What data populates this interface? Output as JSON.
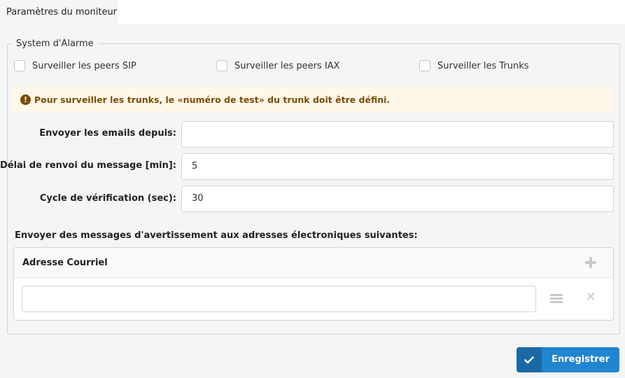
{
  "tabs": [
    {
      "label": "Paramètres du moniteur",
      "active": true
    }
  ],
  "fieldset": {
    "legend": "System d'Alarme"
  },
  "checkboxes": [
    {
      "label": "Surveiller les peers SIP",
      "checked": false
    },
    {
      "label": "Surveiller les peers IAX",
      "checked": false
    },
    {
      "label": "Surveiller les Trunks",
      "checked": false
    }
  ],
  "warning": {
    "icon": "exclamation-circle-icon",
    "text": "Pour surveiller les trunks, le «numéro de test» du trunk doit être défini."
  },
  "form": {
    "email_from": {
      "label": "Envoyer les emails depuis:",
      "value": ""
    },
    "resend_delay": {
      "label": "Délai de renvoi du message [min]:",
      "value": "5"
    },
    "check_cycle": {
      "label": "Cycle de vérification (sec):",
      "value": "30"
    }
  },
  "emails_section": {
    "title": "Envoyer des messages d'avertissement aux adresses électroniques suivantes:",
    "column_header": "Adresse Courriel",
    "rows": [
      {
        "value": ""
      }
    ]
  },
  "save_button": {
    "label": "Enregistrer",
    "icon": "check-icon"
  },
  "colors": {
    "primary": "#2185d0",
    "warning_bg": "#fff8ea",
    "warning_text": "#7a4d05"
  }
}
